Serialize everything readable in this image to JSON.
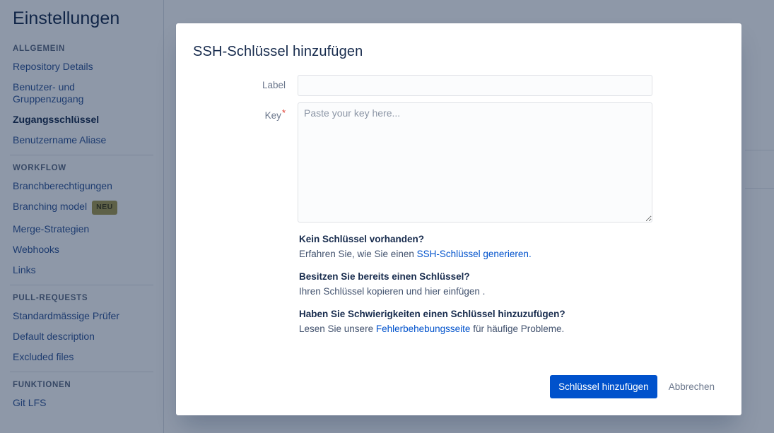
{
  "page": {
    "title": "Einstellungen"
  },
  "sidebar": {
    "sections": [
      {
        "heading": "ALLGEMEIN",
        "items": [
          {
            "label": "Repository Details",
            "active": false
          },
          {
            "label": "Benutzer- und Gruppenzugang",
            "active": false
          },
          {
            "label": "Zugangsschlüssel",
            "active": true
          },
          {
            "label": "Benutzername Aliase",
            "active": false
          }
        ]
      },
      {
        "heading": "WORKFLOW",
        "items": [
          {
            "label": "Branchberechtigungen",
            "active": false
          },
          {
            "label": "Branching model",
            "active": false,
            "badge": "NEU"
          },
          {
            "label": "Merge-Strategien",
            "active": false
          },
          {
            "label": "Webhooks",
            "active": false
          },
          {
            "label": "Links",
            "active": false
          }
        ]
      },
      {
        "heading": "PULL-REQUESTS",
        "items": [
          {
            "label": "Standardmässige Prüfer",
            "active": false
          },
          {
            "label": "Default description",
            "active": false
          },
          {
            "label": "Excluded files",
            "active": false
          }
        ]
      },
      {
        "heading": "FUNKTIONEN",
        "items": [
          {
            "label": "Git LFS",
            "active": false
          }
        ]
      }
    ]
  },
  "dialog": {
    "title": "SSH-Schlüssel hinzufügen",
    "fields": {
      "label": {
        "label": "Label",
        "value": "",
        "placeholder": "",
        "required": false
      },
      "key": {
        "label": "Key",
        "required_marker": "*",
        "value": "",
        "placeholder": "Paste your key here...",
        "required": true
      }
    },
    "help": [
      {
        "question": "Kein Schlüssel vorhanden?",
        "answer_before": "Erfahren Sie, wie Sie einen ",
        "answer_link": "SSH-Schlüssel generieren.",
        "answer_after": ""
      },
      {
        "question": "Besitzen Sie bereits einen Schlüssel?",
        "answer_before": "Ihren Schlüssel kopieren und hier einfügen .",
        "answer_link": "",
        "answer_after": ""
      },
      {
        "question": "Haben Sie Schwierigkeiten einen Schlüssel hinzuzufügen?",
        "answer_before": "Lesen Sie unsere ",
        "answer_link": "Fehlerbehebungsseite",
        "answer_after": " für häufige Probleme."
      }
    ],
    "buttons": {
      "submit": "Schlüssel hinzufügen",
      "cancel": "Abbrechen"
    }
  },
  "colors": {
    "accent": "#0052cc",
    "link": "#0052cc",
    "sidebar_link": "#2f5496",
    "heading": "#172b4d",
    "muted": "#6b778c",
    "overlay": "#8c97a8",
    "badge_new_bg": "#a79a4f",
    "required": "#de3b2f"
  }
}
